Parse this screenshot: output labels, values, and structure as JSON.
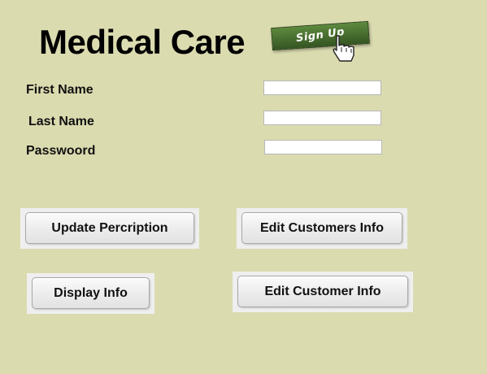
{
  "header": {
    "title": "Medical Care",
    "signup_label": "Sign Up"
  },
  "form": {
    "first_name_label": "First Name",
    "first_name_value": "",
    "last_name_label": "Last Name",
    "last_name_value": "",
    "password_label": "Passwoord",
    "password_value": ""
  },
  "buttons": {
    "update_prescription": "Update Percription",
    "edit_customers_info": "Edit Customers Info",
    "display_info": "Display Info",
    "edit_customer_info": "Edit Customer Info"
  },
  "colors": {
    "background": "#dbdbb0",
    "signup_green": "#4a7030"
  },
  "icons": {
    "signup_pointer": "hand-pointer-icon"
  }
}
